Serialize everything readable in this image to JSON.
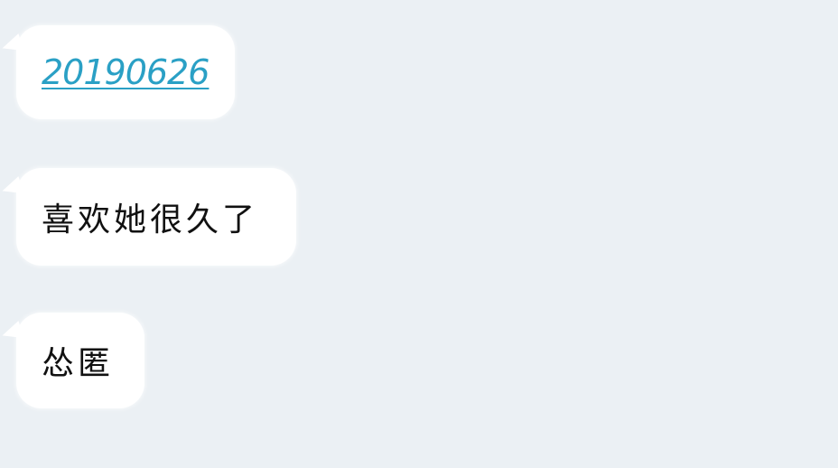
{
  "messages": [
    {
      "text": "20190626",
      "type": "link"
    },
    {
      "text": "喜欢她很久了",
      "type": "text"
    },
    {
      "text": "怂匿",
      "type": "text"
    }
  ],
  "colors": {
    "background": "#ebf0f4",
    "bubble": "#ffffff",
    "link": "#2aa0c5",
    "text": "#111111"
  }
}
